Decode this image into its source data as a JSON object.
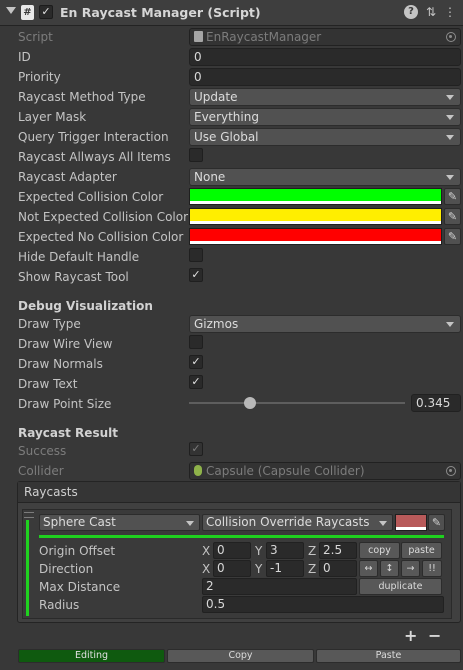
{
  "header": {
    "title": "En Raycast Manager (Script)",
    "script_icon": "#",
    "enabled_mark": "✓",
    "help_icon": "?",
    "settings_icon": "⇅",
    "menu_icon": "⋮"
  },
  "fields": {
    "script": {
      "label": "Script",
      "value": "EnRaycastManager"
    },
    "id": {
      "label": "ID",
      "value": "0"
    },
    "priority": {
      "label": "Priority",
      "value": "0"
    },
    "raycast_method_type": {
      "label": "Raycast Method Type",
      "value": "Update"
    },
    "layer_mask": {
      "label": "Layer Mask",
      "value": "Everything"
    },
    "query_trigger_interaction": {
      "label": "Query Trigger Interaction",
      "value": "Use Global"
    },
    "raycast_always_all_items": {
      "label": "Raycast Allways All Items",
      "checked": false
    },
    "raycast_adapter": {
      "label": "Raycast Adapter",
      "value": "None"
    },
    "expected_collision_color": {
      "label": "Expected Collision Color",
      "color": "#00ff00"
    },
    "not_expected_collision_color": {
      "label": "Not Expected Collision Color",
      "color": "#ffee00"
    },
    "expected_no_collision_color": {
      "label": "Expected No Collision Color",
      "color": "#ff0000"
    },
    "hide_default_handle": {
      "label": "Hide Default Handle",
      "checked": false
    },
    "show_raycast_tool": {
      "label": "Show Raycast Tool",
      "checked": true
    }
  },
  "debug": {
    "section_title": "Debug Visualization",
    "draw_type": {
      "label": "Draw Type",
      "value": "Gizmos"
    },
    "draw_wire_view": {
      "label": "Draw Wire View",
      "checked": false
    },
    "draw_normals": {
      "label": "Draw Normals",
      "checked": true
    },
    "draw_text": {
      "label": "Draw Text",
      "checked": true
    },
    "draw_point_size": {
      "label": "Draw Point Size",
      "value": "0.345",
      "fraction": 0.28
    }
  },
  "result": {
    "section_title": "Raycast Result",
    "success": {
      "label": "Success",
      "checked": true
    },
    "collider": {
      "label": "Collider",
      "value": "Capsule (Capsule Collider)"
    }
  },
  "raycasts": {
    "header": "Raycasts",
    "item": {
      "cast_type": "Sphere Cast",
      "override": "Collision Override Raycasts",
      "swatch_color": "#b85a5a",
      "origin_offset": {
        "label": "Origin Offset",
        "x": "0",
        "y": "3",
        "z": "2.5"
      },
      "direction": {
        "label": "Direction",
        "x": "0",
        "y": "-1",
        "z": "0"
      },
      "max_distance": {
        "label": "Max Distance",
        "value": "2"
      },
      "radius": {
        "label": "Radius",
        "value": "0.5"
      },
      "copy_label": "copy",
      "paste_label": "paste",
      "duplicate_label": "duplicate",
      "dir_buttons": [
        "↔",
        "↕",
        "→",
        "!!"
      ]
    },
    "add_label": "+",
    "remove_label": "−"
  },
  "axis_labels": {
    "x": "X",
    "y": "Y",
    "z": "Z"
  },
  "bottom": {
    "editing": "Editing",
    "copy": "Copy",
    "paste": "Paste"
  },
  "check_mark": "✓",
  "picker_icon": "✎"
}
